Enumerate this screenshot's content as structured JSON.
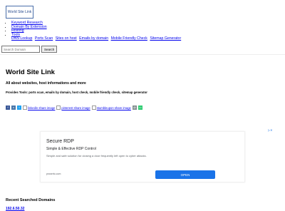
{
  "logo": {
    "text": "World Site Link"
  },
  "nav": {
    "items": [
      {
        "label": "Keyword Research"
      },
      {
        "label": "Domain By Extension"
      },
      {
        "label": "Hosting"
      },
      {
        "label": "Tools"
      }
    ],
    "tools_sub": [
      {
        "label": "DNS Lookup"
      },
      {
        "label": "Ports Scan"
      },
      {
        "label": "Sites on host"
      },
      {
        "label": "Emails by domain"
      },
      {
        "label": "Mobile Friendly Check"
      },
      {
        "label": "Sitemap Generator"
      }
    ]
  },
  "search": {
    "placeholder": "Search Domain",
    "button_label": "Search"
  },
  "main": {
    "title": "World Site Link",
    "subtitle": "All about websites, host informations and more",
    "tools_text": "Provides Tools: ports scan, emails by domain, host check, mobile friendly check, sitemap generator"
  },
  "share": {
    "icons": [
      {
        "name": "facebook-icon",
        "color": "#3b5998",
        "glyph": "f"
      },
      {
        "name": "vk-icon",
        "color": "#4a76a8",
        "glyph": "v"
      },
      {
        "name": "twitter-icon",
        "color": "#1da1f2",
        "glyph": "t"
      }
    ],
    "broken_images": [
      {
        "alt": "linkedin share image"
      },
      {
        "alt": "pinterest share image"
      },
      {
        "alt": "stumbleupon share image"
      }
    ],
    "tail_icons": [
      {
        "name": "email-icon",
        "color": "#7f8c8d",
        "glyph": "@"
      },
      {
        "name": "sms-icon",
        "color": "#2ecc71",
        "glyph": "▭"
      }
    ]
  },
  "ad": {
    "title": "Secure RDP",
    "headline": "Simple & Effective RDP Control",
    "description": "Simple and safe solution for closing a door frequently left open to cyber attacks.",
    "domain": "proserto.com",
    "button_label": "OPEN",
    "accent": "#1a73e8"
  },
  "recent": {
    "title": "Recent Searched Domains",
    "items": [
      {
        "label": "192.6.50.32"
      }
    ]
  }
}
